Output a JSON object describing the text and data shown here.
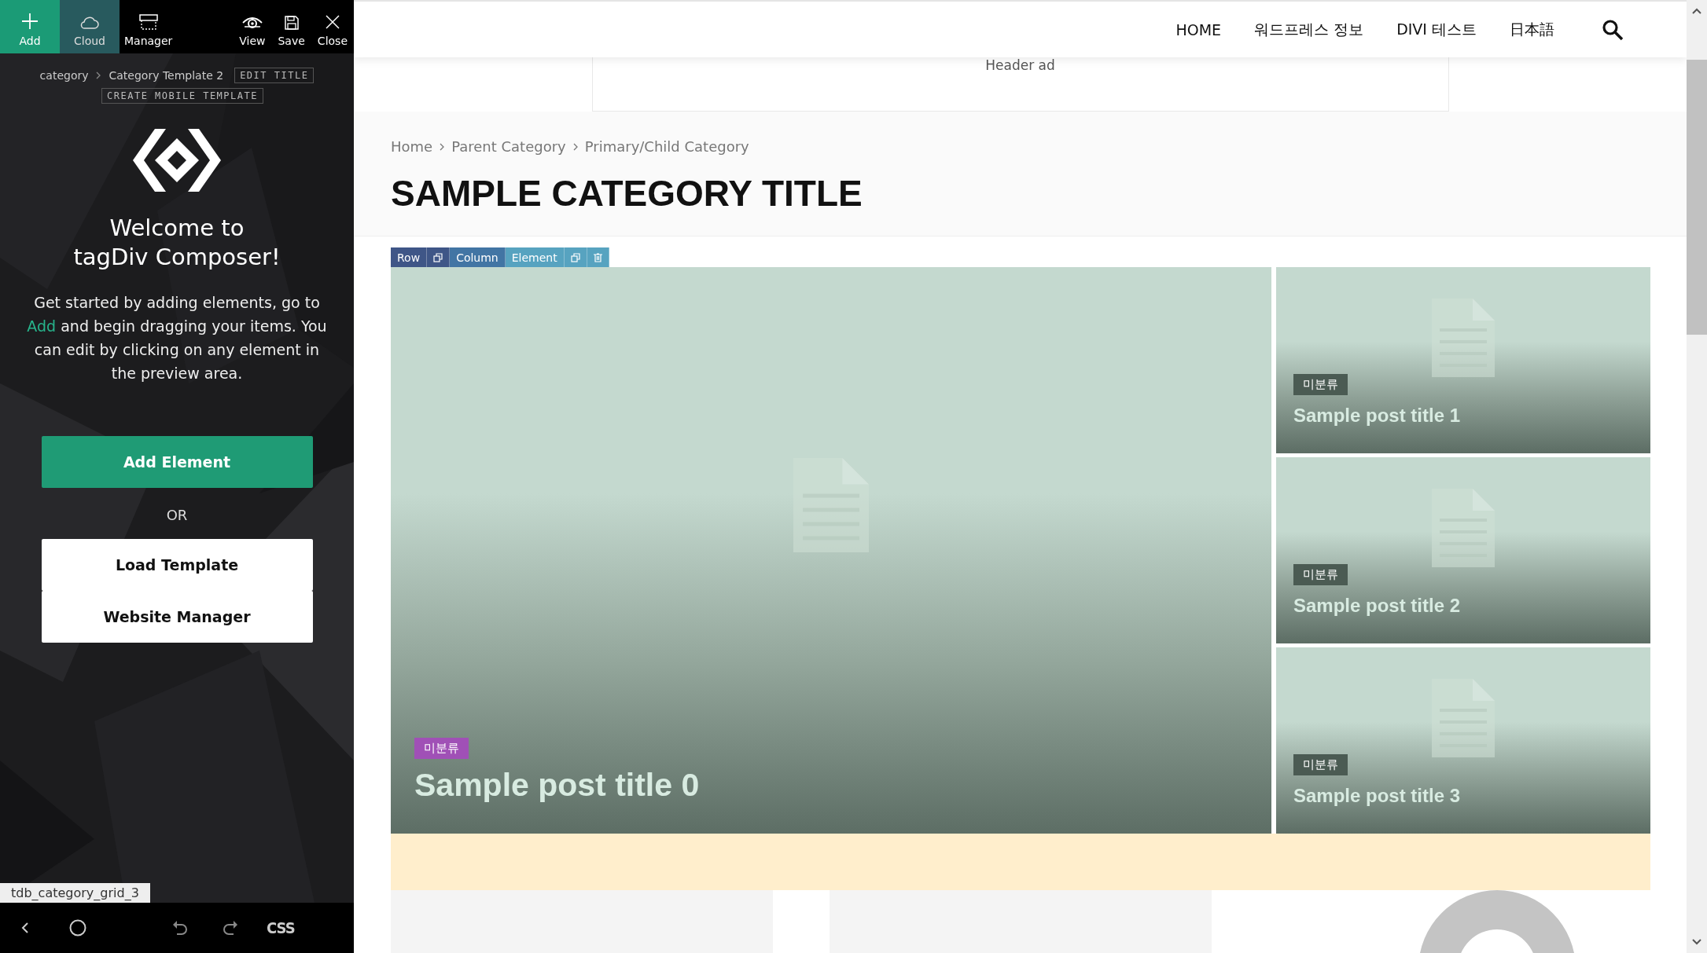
{
  "editor": {
    "toolbar": [
      {
        "label": "Add",
        "kind": "add"
      },
      {
        "label": "Cloud",
        "kind": "cloud"
      },
      {
        "label": "Manager",
        "kind": "manager"
      },
      {
        "label": "View",
        "kind": "view"
      },
      {
        "label": "Save",
        "kind": "save"
      },
      {
        "label": "Close",
        "kind": "close"
      }
    ],
    "breadcrumb": [
      "category",
      "Category Template 2"
    ],
    "edit_title_button": "EDIT TITLE",
    "mobile_template_button": "CREATE MOBILE TEMPLATE",
    "welcome_lines": [
      "Welcome to",
      "tagDiv Composer!"
    ],
    "intro": {
      "before": "Get started by adding elements, go to",
      "link": "Add",
      "after": "and begin dragging your items. You can edit by clicking on any element in the preview area."
    },
    "buttons": [
      {
        "label": "Add Element",
        "kind": "primary"
      },
      {
        "label": "Load Template",
        "kind": "secondary"
      },
      {
        "label": "Website Manager",
        "kind": "secondary"
      }
    ],
    "or_label": "OR",
    "element_tag": "tdb_category_grid_3",
    "bottom_bar": [
      {
        "kind": "back"
      },
      {
        "kind": "home"
      },
      {
        "kind": "undo"
      },
      {
        "kind": "redo"
      },
      {
        "kind": "css",
        "label": "CSS"
      }
    ]
  },
  "site": {
    "nav": [
      "HOME",
      "워드프레스 정보",
      "DIVI 테스트",
      "日本語"
    ],
    "header_ad": "Header ad",
    "breadcrumbs": [
      "Home",
      "Parent Category",
      "Primary/Child Category"
    ],
    "category_title": "SAMPLE CATEGORY TITLE",
    "builder_toolbar": [
      {
        "kind": "row",
        "label": "Row"
      },
      {
        "kind": "row-copy"
      },
      {
        "kind": "column",
        "label": "Column"
      },
      {
        "kind": "element",
        "label": "Element"
      },
      {
        "kind": "element-copy"
      },
      {
        "kind": "element-delete"
      }
    ],
    "posts": [
      {
        "title": "Sample post title 0",
        "category": "미분류",
        "color": "#a050b6"
      },
      {
        "title": "Sample post title 1",
        "category": "미분류",
        "color": "#4b5b53"
      },
      {
        "title": "Sample post title 2",
        "category": "미분류",
        "color": "#4b5b53"
      },
      {
        "title": "Sample post title 3",
        "category": "미분류",
        "color": "#4b5b53"
      }
    ]
  }
}
